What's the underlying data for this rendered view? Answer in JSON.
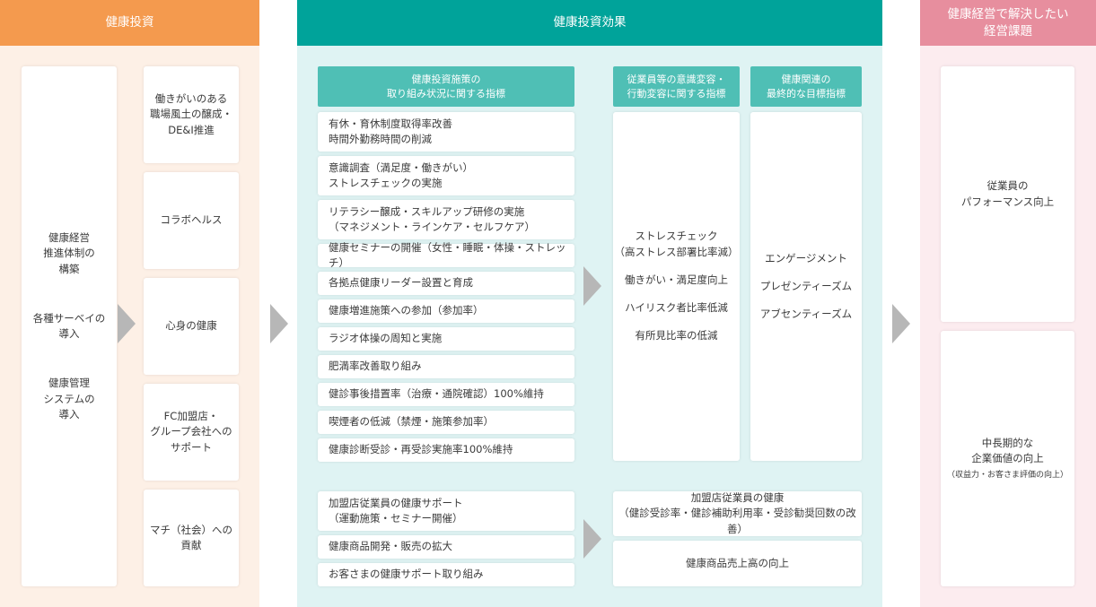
{
  "colors": {
    "investment_header": "#f49a4e",
    "investment_bg": "#fdf0e6",
    "effects_header": "#00a39a",
    "effects_sub_header": "#4fbfb5",
    "effects_bg": "#dff3f3",
    "issues_header": "#e78e9e",
    "issues_bg": "#fcecef",
    "arrow": "#b7b7b7"
  },
  "investment": {
    "header": "健康投資",
    "foundations": [
      "健康経営\n推進体制の\n構築",
      "各種サーベイの\n導入",
      "健康管理\nシステムの\n導入"
    ],
    "pillars": [
      "働きがいのある\n職場風土の醸成・\nDE&I推進",
      "コラボヘルス",
      "心身の健康",
      "FC加盟店・\nグループ会社への\nサポート",
      "マチ（社会）への\n貢献"
    ]
  },
  "effects": {
    "header": "健康投資効果",
    "col1_header": "健康投資施策の\n取り組み状況に関する指標",
    "col2_header": "従業員等の意識変容・\n行動変容に関する指標",
    "col3_header": "健康関連の\n最終的な目標指標",
    "measures": [
      "有休・育休制度取得率改善\n時間外勤務時間の削減",
      "意識調査（満足度・働きがい）\nストレスチェックの実施",
      "リテラシー醸成・スキルアップ研修の実施\n（マネジメント・ラインケア・セルフケア）",
      "健康セミナーの開催（女性・睡眠・体操・ストレッチ）",
      "各拠点健康リーダー設置と育成",
      "健康増進施策への参加（参加率）",
      "ラジオ体操の周知と実施",
      "肥満率改善取り組み",
      "健診事後措置率（治療・通院確認）100%維持",
      "喫煙者の低減（禁煙・施策参加率）",
      "健康診断受診・再受診実施率100%維持"
    ],
    "behavior_indicators": [
      "ストレスチェック\n（高ストレス部署比率減）",
      "働きがい・満足度向上",
      "ハイリスク者比率低減",
      "有所見比率の低減"
    ],
    "final_indicators": [
      "エンゲージメント",
      "プレゼンティーズム",
      "アブセンティーズム"
    ],
    "franchise_measures": [
      "加盟店従業員の健康サポート\n（運動施策・セミナー開催）",
      "健康商品開発・販売の拡大",
      "お客さまの健康サポート取り組み"
    ],
    "franchise_outcomes": [
      "加盟店従業員の健康\n（健診受診率・健診補助利用率・受診勧奨回数の改善）",
      "健康商品売上高の向上"
    ]
  },
  "issues": {
    "header": "健康経営で解決したい\n経営課題",
    "items": [
      {
        "label": "従業員の\nパフォーマンス向上",
        "note": ""
      },
      {
        "label": "中長期的な\n企業価値の向上",
        "note": "（収益力・お客さま評価の向上）"
      }
    ]
  }
}
